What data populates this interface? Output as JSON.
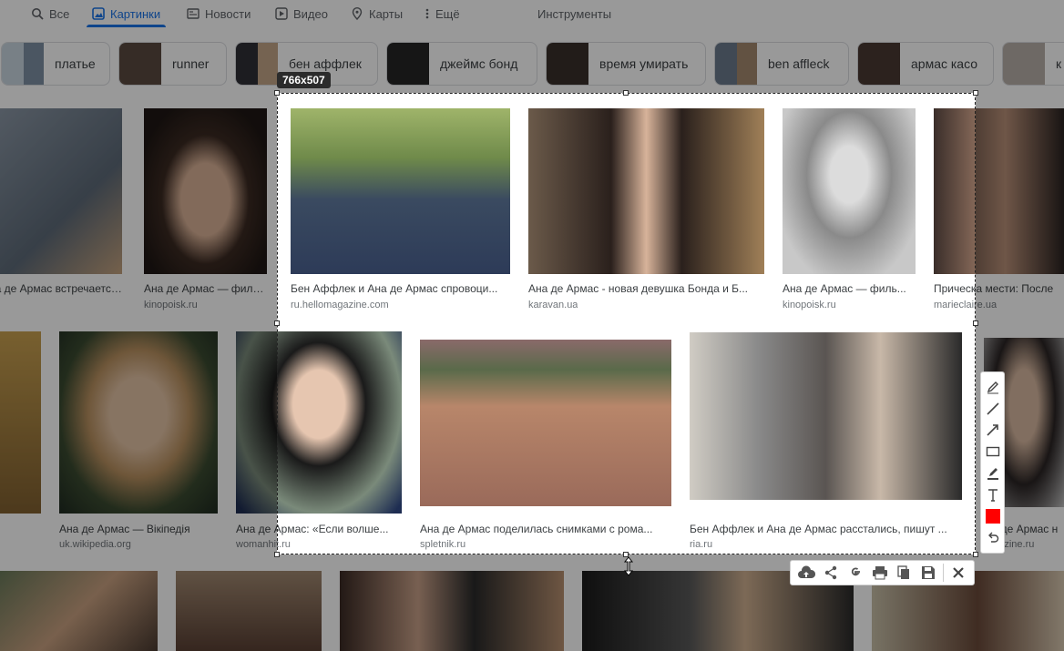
{
  "tabs": [
    {
      "label": "Все",
      "icon": "search-icon"
    },
    {
      "label": "Картинки",
      "icon": "image-icon",
      "active": true
    },
    {
      "label": "Новости",
      "icon": "news-icon"
    },
    {
      "label": "Видео",
      "icon": "play-icon"
    },
    {
      "label": "Карты",
      "icon": "map-pin-icon"
    },
    {
      "label": "Ещё",
      "icon": "more-vert-icon"
    }
  ],
  "tools_label": "Инструменты",
  "chips": [
    "платье",
    "runner",
    "бен аффлек",
    "джеймс бонд",
    "время умирать",
    "ben affleck",
    "армас касо",
    "к"
  ],
  "results": {
    "row1": [
      {
        "caption": "Ана де Армас встречается с Бе...",
        "source": ""
      },
      {
        "caption": "Ана де Армас — филь...",
        "source": "kinopoisk.ru"
      },
      {
        "caption": "Бен Аффлек и Ана де Армас спровоци...",
        "source": "ru.hellomagazine.com"
      },
      {
        "caption": "Ана де Армас - новая девушка Бонда и Б...",
        "source": "karavan.ua"
      },
      {
        "caption": "Ана де Армас — филь...",
        "source": "kinopoisk.ru"
      },
      {
        "caption": "Прическа мести: После",
        "source": "marieclaire.ua"
      }
    ],
    "row2": [
      {
        "caption": "Ана де Армас — Вікіпедія",
        "source": "uk.wikipedia.org"
      },
      {
        "caption": "Ана де Армас: «Если волше...",
        "source": "womanhit.ru"
      },
      {
        "caption": "Ана де Армас поделилась снимками с рома...",
        "source": "spletnik.ru"
      },
      {
        "caption": "Бен Аффлек и Ана де Армас расстались, пишут ...",
        "source": "ria.ru"
      },
      {
        "caption": "Ана де Армас н",
        "source": "agazine.ru"
      }
    ]
  },
  "selection": {
    "size_label": "766x507"
  },
  "side_tools": [
    "pencil-icon",
    "line-icon",
    "arrow-icon",
    "rectangle-icon",
    "marker-icon",
    "text-icon",
    "color-swatch",
    "undo-icon"
  ],
  "bottom_tools": [
    "cloud-upload-icon",
    "share-icon",
    "google-icon",
    "print-icon",
    "copy-icon",
    "save-icon",
    "close-icon"
  ],
  "colors": {
    "accent": "#1a73e8",
    "selected_color": "#ff0000"
  }
}
